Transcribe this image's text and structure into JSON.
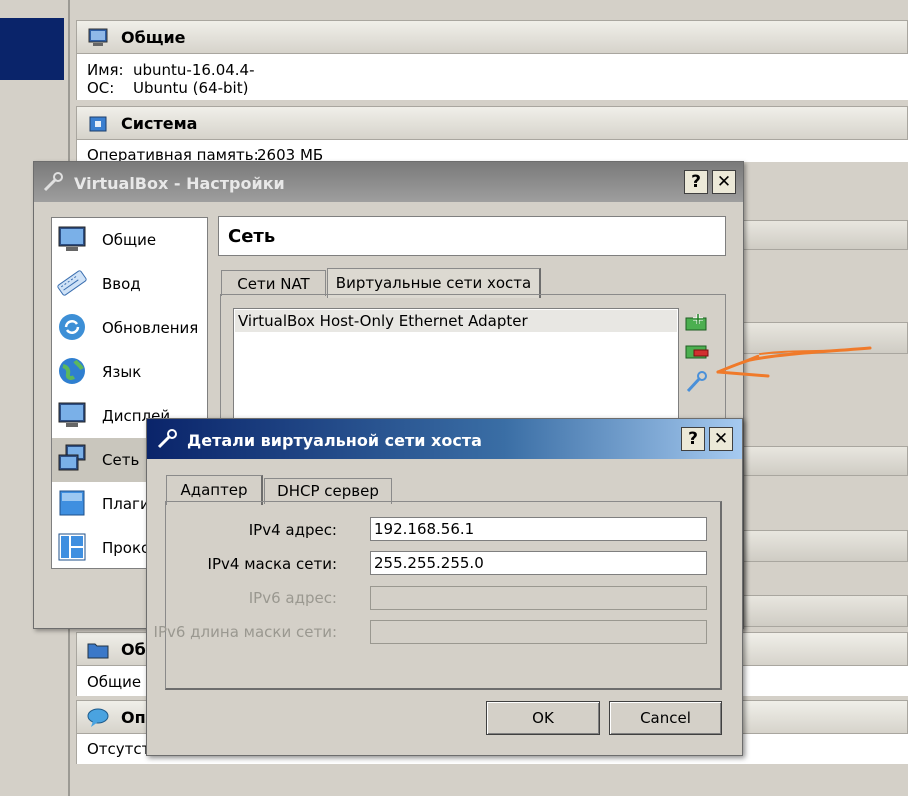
{
  "manager": {
    "general": {
      "title": "Общие",
      "name_label": "Имя:",
      "name_value": "ubuntu-16.04.4-",
      "os_label": "ОС:",
      "os_value": "Ubuntu (64-bit)"
    },
    "system": {
      "title": "Система",
      "ram_label": "Оперативная память:",
      "ram_value": "2603 МБ"
    },
    "shared": {
      "title": "Об",
      "body": "Общие"
    },
    "description": {
      "title": "Оп",
      "body": "Отсутст"
    }
  },
  "settings": {
    "title": "VirtualBox - Настройки",
    "help": "?",
    "close": "✕",
    "sidebar": [
      {
        "label": "Общие",
        "icon": "monitor-icon"
      },
      {
        "label": "Ввод",
        "icon": "keyboard-icon"
      },
      {
        "label": "Обновления",
        "icon": "refresh-icon"
      },
      {
        "label": "Язык",
        "icon": "globe-icon"
      },
      {
        "label": "Дисплей",
        "icon": "display-icon"
      },
      {
        "label": "Сеть",
        "icon": "network-icon",
        "selected": true
      },
      {
        "label": "Плагины",
        "icon": "plugin-icon"
      },
      {
        "label": "Прокси",
        "icon": "proxy-icon"
      }
    ],
    "page_title": "Сеть",
    "tabs": [
      {
        "label": "Сети NAT"
      },
      {
        "label": "Виртуальные сети хоста",
        "active": true
      }
    ],
    "networks": [
      "VirtualBox Host-Only Ethernet Adapter"
    ],
    "tools": [
      "add-network-icon",
      "remove-network-icon",
      "edit-network-icon"
    ]
  },
  "details": {
    "title": "Детали виртуальной сети хоста",
    "help": "?",
    "close": "✕",
    "tabs": [
      {
        "label": "Адаптер",
        "active": true
      },
      {
        "label": "DHCP сервер"
      }
    ],
    "fields": [
      {
        "label": "IPv4 адрес:",
        "value": "192.168.56.1",
        "enabled": true
      },
      {
        "label": "IPv4 маска сети:",
        "value": "255.255.255.0",
        "enabled": true
      },
      {
        "label": "IPv6 адрес:",
        "value": "",
        "enabled": false
      },
      {
        "label": "IPv6 длина маски сети:",
        "value": "",
        "enabled": false
      }
    ],
    "ok_label": "OK",
    "cancel_label": "Cancel"
  },
  "colors": {
    "annotation": "#f07a2a",
    "titlebar_active": "#0a246a"
  }
}
